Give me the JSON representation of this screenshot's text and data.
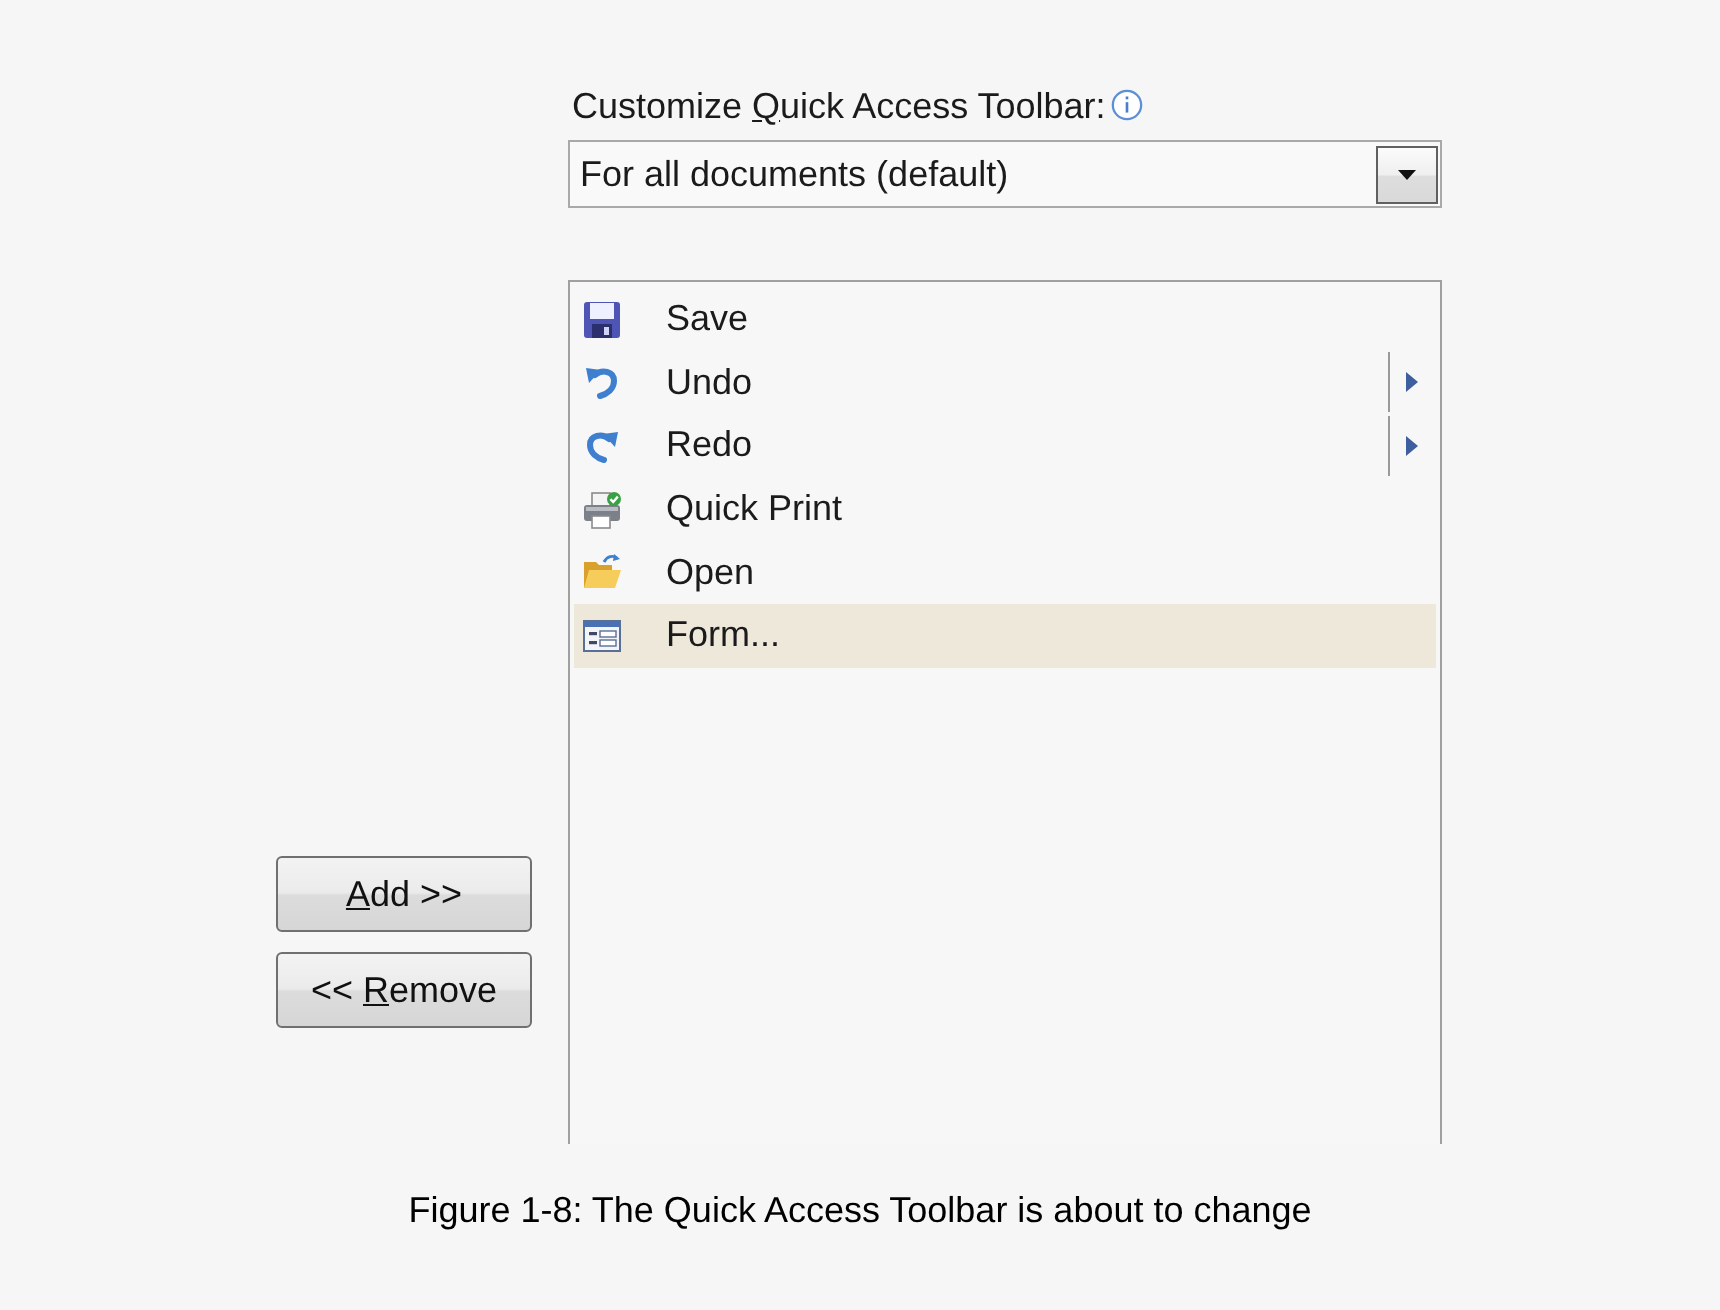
{
  "toolbar_setting": {
    "label": {
      "before": "Customize ",
      "access_key": "Q",
      "after": "uick Access Toolbar:"
    },
    "dropdown": {
      "value": "For all documents (default)"
    }
  },
  "buttons": [
    {
      "access_key": "A",
      "after": "dd >>"
    },
    {
      "before": "<< ",
      "access_key": "R",
      "after": "emove"
    }
  ],
  "commands": [
    {
      "kind": "save",
      "label": "Save",
      "has_submenu": false,
      "selected": false
    },
    {
      "kind": "undo",
      "label": "Undo",
      "has_submenu": true,
      "selected": false
    },
    {
      "kind": "redo",
      "label": "Redo",
      "has_submenu": true,
      "selected": false
    },
    {
      "kind": "print",
      "label": "Quick Print",
      "has_submenu": false,
      "selected": false
    },
    {
      "kind": "open",
      "label": "Open",
      "has_submenu": false,
      "selected": false
    },
    {
      "kind": "form",
      "label": "Form...",
      "has_submenu": false,
      "selected": true
    }
  ],
  "caption": "Figure 1-8: The Quick Access Toolbar is about to change"
}
